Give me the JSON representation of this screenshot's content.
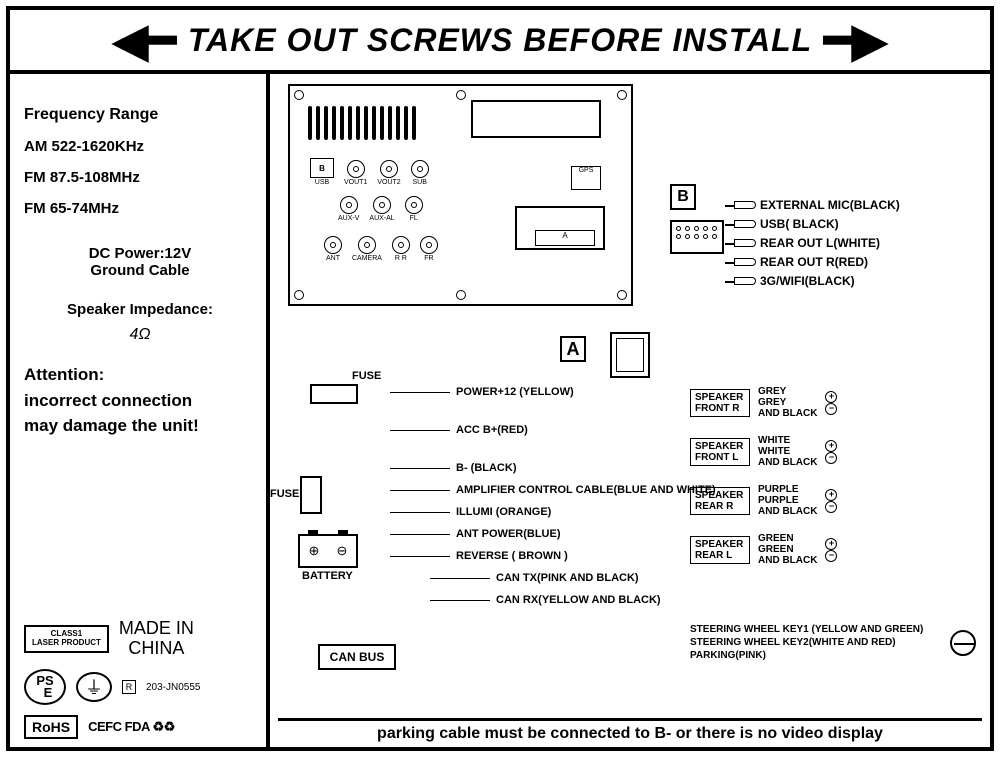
{
  "header": {
    "title": "TAKE OUT SCREWS BEFORE INSTALL"
  },
  "specs": {
    "freq_title": "Frequency Range",
    "am": "AM 522-1620KHz",
    "fm1": "FM 87.5-108MHz",
    "fm2": "FM 65-74MHz",
    "dc": "DC Power:12V",
    "ground": "Ground Cable",
    "imp_title": "Speaker Impedance:",
    "imp_val": "4Ω"
  },
  "warning": {
    "l1": "Attention:",
    "l2": "incorrect connection",
    "l3": "may damage the unit!"
  },
  "badges": {
    "class1_l1": "CLASS1",
    "class1_l2": "LASER PRODUCT",
    "made_l1": "MADE IN",
    "made_l2": "CHINA",
    "pse": "PS E",
    "r_code": "203-JN0555",
    "rohs": "RoHS",
    "certs": "CEFC FDA ♻♻"
  },
  "device": {
    "ports_r1": [
      "B",
      "VOUT1",
      "VOUT2",
      "SUB"
    ],
    "usb_label": "USB",
    "ports_r2": [
      "AUX-V",
      "AUX-AL",
      "FL"
    ],
    "ports_r3": [
      "ANT",
      "CAMERA",
      "R R",
      "FR"
    ],
    "gps": "GPS",
    "conn_a": "A"
  },
  "b_module": {
    "label": "B",
    "wires": [
      "EXTERNAL MIC(BLACK)",
      "USB( BLACK)",
      "REAR OUT L(WHITE)",
      "REAR OUT R(RED)",
      "3G/WIFI(BLACK)"
    ]
  },
  "a_module": {
    "label": "A"
  },
  "fuse": {
    "label1": "FUSE",
    "label2": "FUSE",
    "battery": "BATTERY"
  },
  "harness_left": [
    "POWER+12 (YELLOW)",
    "ACC B+(RED)",
    "B- (BLACK)",
    "AMPLIFIER CONTROL CABLE(BLUE AND WHITE)",
    "ILLUMI (ORANGE)",
    "ANT POWER(BLUE)",
    "REVERSE ( BROWN )",
    "CAN TX(PINK AND BLACK)",
    "CAN RX(YELLOW AND BLACK)"
  ],
  "canbus": "CAN BUS",
  "speakers": [
    {
      "box_l1": "SPEAKER",
      "box_l2": "FRONT   R",
      "c1": "GREY",
      "c2": "GREY",
      "c3": "AND BLACK"
    },
    {
      "box_l1": "SPEAKER",
      "box_l2": "FRONT   L",
      "c1": "WHITE",
      "c2": "WHITE",
      "c3": "AND BLACK"
    },
    {
      "box_l1": "SPEAKER",
      "box_l2": "REAR    R",
      "c1": "PURPLE",
      "c2": "PURPLE",
      "c3": "AND BLACK"
    },
    {
      "box_l1": "SPEAKER",
      "box_l2": "REAR    L",
      "c1": "GREEN",
      "c2": "GREEN",
      "c3": "AND BLACK"
    }
  ],
  "steering": {
    "l1": "STEERING WHEEL KEY1 (YELLOW AND GREEN)",
    "l2": "STEERING  WHEEL KEY2(WHITE AND RED)",
    "l3": "PARKING(PINK)"
  },
  "bottom_note": "parking cable must be connected to B- or there is no video display"
}
